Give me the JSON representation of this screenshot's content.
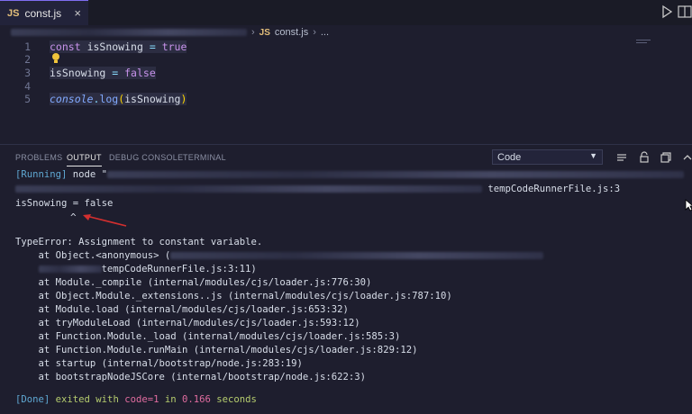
{
  "tab": {
    "badge": "JS",
    "label": "const.js",
    "close": "×"
  },
  "breadcrumb": {
    "badge": "JS",
    "file": "const.js",
    "separator": "›",
    "ellipsis": "..."
  },
  "editor": {
    "lines": [
      {
        "number": "1"
      },
      {
        "number": "2"
      },
      {
        "number": "3"
      },
      {
        "number": "4"
      },
      {
        "number": "5"
      }
    ],
    "line1": {
      "kw": "const",
      "name": "isSnowing",
      "op": "=",
      "value": "true"
    },
    "line3": {
      "name": "isSnowing",
      "op": "=",
      "value": "false"
    },
    "line5": {
      "obj": "console",
      "dot": ".",
      "fn": "log",
      "open": "(",
      "arg": "isSnowing",
      "close": ")"
    }
  },
  "panel": {
    "tabs": [
      "PROBLEMS",
      "OUTPUT",
      "DEBUG CONSOLE",
      "TERMINAL"
    ],
    "active_tab": "OUTPUT",
    "channel_select": "Code",
    "output": {
      "running_tag": "[Running]",
      "running_cmd": "node \"",
      "path_end": "tempCodeRunnerFile.js:3",
      "error_line": "isSnowing = false",
      "caret": "^",
      "type_error": "TypeError: Assignment to constant variable.",
      "anon": "    at Object.<anonymous> (",
      "trace_file": "tempCodeRunnerFile.js:3:11)",
      "stack": [
        "    at Module._compile (internal/modules/cjs/loader.js:776:30)",
        "    at Object.Module._extensions..js (internal/modules/cjs/loader.js:787:10)",
        "    at Module.load (internal/modules/cjs/loader.js:653:32)",
        "    at tryModuleLoad (internal/modules/cjs/loader.js:593:12)",
        "    at Function.Module._load (internal/modules/cjs/loader.js:585:3)",
        "    at Function.Module.runMain (internal/modules/cjs/loader.js:829:12)",
        "    at startup (internal/bootstrap/node.js:283:19)",
        "    at bootstrapNodeJSCore (internal/bootstrap/node.js:622:3)"
      ],
      "done_tag": "[Done]",
      "done_text": " exited with ",
      "done_code": "code=1",
      "done_in": " in ",
      "done_time": "0.166",
      "done_unit": " seconds"
    }
  },
  "colors": {
    "accent": "#7f6df2",
    "keyword": "#c792ea",
    "function": "#82aaff",
    "error_arrow": "#d32f2f"
  }
}
